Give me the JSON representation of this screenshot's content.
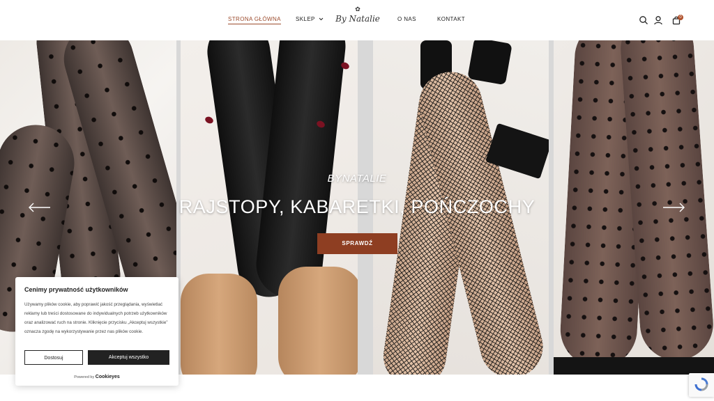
{
  "header": {
    "nav": {
      "home": "STRONA GŁÓWNA",
      "shop": "SKLEP",
      "about": "O NAS",
      "contact": "KONTAKT"
    },
    "logo_text": "By Natalie",
    "cart_count": "0",
    "icons": [
      "search-icon",
      "user-icon",
      "cart-icon",
      "chevron-down-icon"
    ]
  },
  "hero": {
    "subtitle": "BYNATALIE",
    "headline": "RAJSTOPY, KABARETKI, POŃCZOCHY",
    "cta_label": "SPRAWDŹ",
    "icons": [
      "arrow-left-icon",
      "arrow-right-icon"
    ]
  },
  "cookie": {
    "title": "Cenimy prywatność użytkowników",
    "text": "Używamy plików cookie, aby poprawić jakość przeglądania, wyświetlać reklamy lub treści dostosowane do indywidualnych potrzeb użytkowników oraz analizować ruch na stronie. Kliknięcie przycisku „Akceptuj wszystkie” oznacza zgodę na wykorzystywanie przez nas plików cookie.",
    "reject_label": "Dostosuj",
    "accept_label": "Akceptuj wszystko",
    "powered_by": "Powered by",
    "brand": "Cookieyes"
  },
  "colors": {
    "accent": "#9b4b2c",
    "cta": "#8e3e22",
    "dark": "#222222"
  }
}
